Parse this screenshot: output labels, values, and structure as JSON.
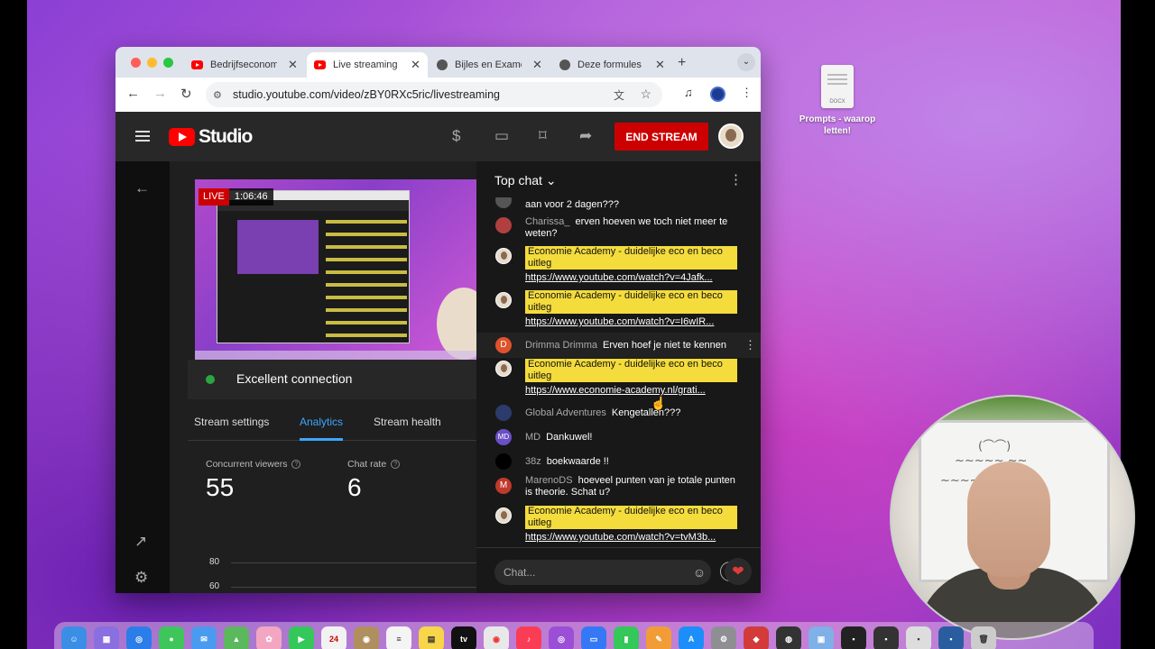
{
  "browser": {
    "tabs": [
      {
        "title": "Bedrijfseconomie",
        "icon": "youtube-icon",
        "active": false
      },
      {
        "title": "Live streaming",
        "icon": "youtube-icon",
        "active": true
      },
      {
        "title": "Bijles en Examen",
        "icon": "site-icon",
        "active": false
      },
      {
        "title": "Deze formules moet",
        "icon": "site-icon",
        "active": false
      }
    ],
    "url": "studio.youtube.com/video/zBY0RXc5ric/livestreaming"
  },
  "desktop": {
    "file_label": "Prompts - waarop letten!",
    "file_type": "DOCX"
  },
  "studio": {
    "logo_text": "Studio",
    "end_stream_label": "END STREAM"
  },
  "stream": {
    "live_label": "LIVE",
    "elapsed": "1:06:46",
    "connection": "Excellent connection",
    "tabs": [
      "Stream settings",
      "Analytics",
      "Stream health"
    ],
    "active_tab": "Analytics",
    "metrics": [
      {
        "label": "Concurrent viewers",
        "value": "55"
      },
      {
        "label": "Chat rate",
        "value": "6"
      }
    ],
    "axis_ticks": [
      "80",
      "60"
    ]
  },
  "chat": {
    "header": "Top chat",
    "input_placeholder": "Chat...",
    "messages": [
      {
        "author": "",
        "text": "aan voor 2 dagen???"
      },
      {
        "author": "Charissa_",
        "text": "erven hoeven we toch niet meer te weten?"
      },
      {
        "author": "",
        "highlight": "Economie Academy - duidelijke eco en beco uitleg",
        "link": "https://www.youtube.com/watch?v=4Jafk..."
      },
      {
        "author": "",
        "highlight": "Economie Academy - duidelijke eco en beco uitleg",
        "link": "https://www.youtube.com/watch?v=I6wIR..."
      },
      {
        "author": "Drimma Drimma",
        "avatar_letter": "D",
        "text": "Erven hoef je niet te kennen"
      },
      {
        "author": "",
        "highlight": "Economie Academy - duidelijke eco en beco uitleg",
        "link": "https://www.economie-academy.nl/grati..."
      },
      {
        "author": "Global Adventures",
        "text": "Kengetallen???"
      },
      {
        "author": "MD",
        "avatar_letter": "MD",
        "text": "Dankuwel!"
      },
      {
        "author": "38z",
        "text": "boekwaarde !!"
      },
      {
        "author": "MarenoDS",
        "avatar_letter": "M",
        "text": "hoeveel punten van je totale punten is theorie. Schat u?"
      },
      {
        "author": "",
        "highlight": "Economie Academy - duidelijke eco en beco uitleg",
        "link": "https://www.youtube.com/watch?v=tvM3b..."
      }
    ]
  },
  "colors": {
    "accent": "#3ea6ff",
    "end_stream": "#cc0000",
    "highlight": "#f4dc3c",
    "connection_ok": "#2ba640"
  }
}
